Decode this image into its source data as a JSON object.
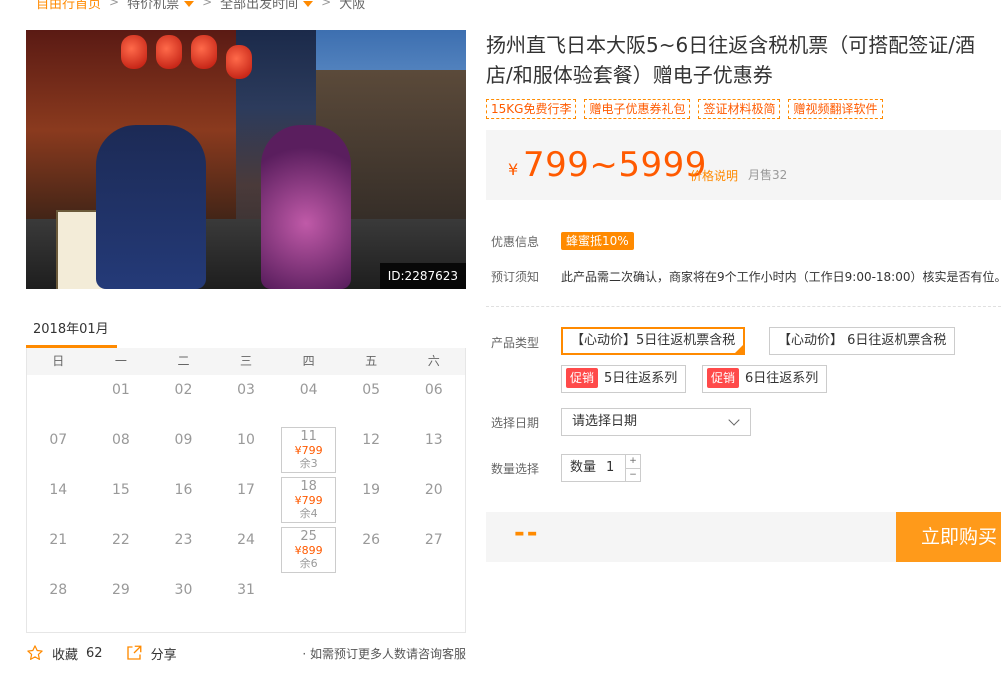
{
  "breadcrumb": {
    "home": "自由行首页",
    "cat": "特价机票",
    "time": "全部出发时间",
    "dest": "大阪"
  },
  "hero": {
    "id_label": "ID:2287623",
    "dots": 9,
    "active_dot": 0
  },
  "calendar": {
    "month": "2018年01月",
    "weekdays": [
      "日",
      "一",
      "二",
      "三",
      "四",
      "五",
      "六"
    ],
    "rows": [
      [
        {
          "d": ""
        },
        {
          "d": "01"
        },
        {
          "d": "02"
        },
        {
          "d": "03"
        },
        {
          "d": "04"
        },
        {
          "d": "05"
        },
        {
          "d": "06"
        }
      ],
      [
        {
          "d": "07"
        },
        {
          "d": "08"
        },
        {
          "d": "09"
        },
        {
          "d": "10"
        },
        {
          "d": "11",
          "price": "¥799",
          "left": "余3"
        },
        {
          "d": "12"
        },
        {
          "d": "13"
        }
      ],
      [
        {
          "d": "14"
        },
        {
          "d": "15"
        },
        {
          "d": "16"
        },
        {
          "d": "17"
        },
        {
          "d": "18",
          "price": "¥799",
          "left": "余4"
        },
        {
          "d": "19"
        },
        {
          "d": "20"
        }
      ],
      [
        {
          "d": "21"
        },
        {
          "d": "22"
        },
        {
          "d": "23"
        },
        {
          "d": "24"
        },
        {
          "d": "25",
          "price": "¥899",
          "left": "余6"
        },
        {
          "d": "26"
        },
        {
          "d": "27"
        }
      ],
      [
        {
          "d": "28"
        },
        {
          "d": "29"
        },
        {
          "d": "30"
        },
        {
          "d": "31"
        },
        {
          "d": ""
        },
        {
          "d": ""
        },
        {
          "d": ""
        }
      ]
    ]
  },
  "actions": {
    "fav_label": "收藏",
    "fav_count": "62",
    "share_label": "分享",
    "note": "· 如需预订更多人数请咨询客服"
  },
  "product": {
    "title_line1": "扬州直飞日本大阪5~6日往返含税机票（可搭配签证/酒",
    "title_line2": "店/和服体验套餐）赠电子优惠券",
    "tags": [
      "15KG免费行李",
      "赠电子优惠券礼包",
      "签证材料极简",
      "赠视频翻译软件"
    ]
  },
  "price": {
    "currency": "¥",
    "range": "799~5999",
    "note_link": "价格说明",
    "sold": "月售32"
  },
  "info": {
    "promo_label": "优惠信息",
    "promo_badge": "蜂蜜抵10%",
    "notice_label": "预订须知",
    "notice_text": "此产品需二次确认，商家将在9个工作小时内（工作日9:00-18:00）核实是否有位。"
  },
  "options": {
    "type_label": "产品类型",
    "items": [
      {
        "text": "【心动价】5日往返机票含税",
        "selected": true
      },
      {
        "text": "【心动价】 6日往返机票含税",
        "selected": false
      },
      {
        "tag": "促销",
        "text": "5日往返系列",
        "selected": false
      },
      {
        "tag": "促销",
        "text": "6日往返系列",
        "selected": false
      }
    ],
    "date_label": "选择日期",
    "date_placeholder": "请选择日期",
    "qty_label": "数量选择",
    "qty_text": "数量",
    "qty_value": "1"
  },
  "buy": {
    "total": "--",
    "button": "立即购买"
  },
  "colors": {
    "accent": "#ff8a00",
    "price": "#ff5a00",
    "promo_red": "#ff4a4a"
  }
}
